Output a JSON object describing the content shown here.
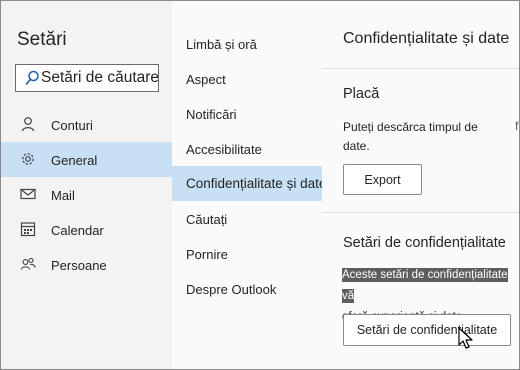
{
  "settings": {
    "title": "Setări",
    "search": {
      "value": "Setări de căutare"
    }
  },
  "nav": [
    {
      "label": "Conturi",
      "icon": "person-icon"
    },
    {
      "label": "General",
      "icon": "gear-icon",
      "selected": true
    },
    {
      "label": "Mail",
      "icon": "mail-icon"
    },
    {
      "label": "Calendar",
      "icon": "calendar-icon"
    },
    {
      "label": "Persoane",
      "icon": "people-icon"
    }
  ],
  "subnav": [
    {
      "label": "Limbă și oră"
    },
    {
      "label": "Aspect"
    },
    {
      "label": "Notificări"
    },
    {
      "label": "Accesibilitate"
    },
    {
      "label": "Confidențialitate și date",
      "selected": true
    },
    {
      "label": "Căutați"
    },
    {
      "label": "Pornire"
    },
    {
      "label": "Despre Outlook"
    }
  ],
  "panel": {
    "title": "Confidențialitate și date",
    "board": {
      "heading": "Placă",
      "description": "Puteți descărca timpul de date.",
      "cut_text": "f",
      "button": "Export"
    },
    "privacy": {
      "heading": "Setări de confidențialitate",
      "description_highlight": "Aceste setări de confidențialitate vă",
      "description_rest": "oferă experiență și date.",
      "button": "Setări de confidențialitate"
    }
  },
  "colors": {
    "selected_bg": "#c7e0f4",
    "left_bg": "#f3f3f3",
    "highlight_bg": "#5e5e5e"
  }
}
